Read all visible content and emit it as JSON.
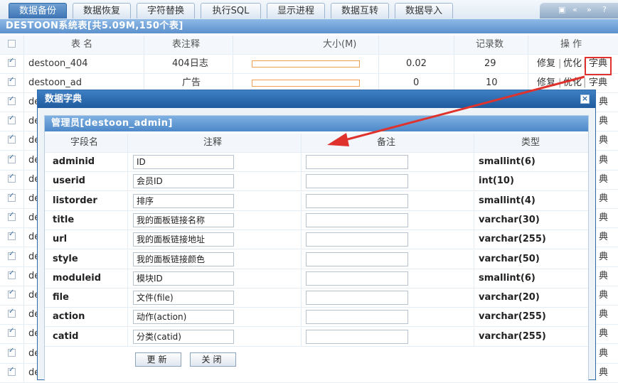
{
  "tabs": [
    {
      "label": "数据备份",
      "active": true
    },
    {
      "label": "数据恢复",
      "active": false
    },
    {
      "label": "字符替换",
      "active": false
    },
    {
      "label": "执行SQL",
      "active": false
    },
    {
      "label": "显示进程",
      "active": false
    },
    {
      "label": "数据互转",
      "active": false
    },
    {
      "label": "数据导入",
      "active": false
    }
  ],
  "toolbar_icons": [
    "pin-icon",
    "back-icon",
    "forward-icon",
    "help-icon"
  ],
  "main_title": "DESTOON系统表[共5.09M,150个表]",
  "bg_table": {
    "headers": {
      "name": "表 名",
      "comment": "表注释",
      "size": "大小(M)",
      "records": "记录数",
      "ops": "操 作"
    },
    "rows": [
      {
        "name": "destoon_404",
        "comment": "404日志",
        "size": "0.02",
        "records": "29",
        "repair": "修复",
        "optimize": "优化",
        "dict": "字典"
      },
      {
        "name": "destoon_ad",
        "comment": "广告",
        "size": "0",
        "records": "10",
        "repair": "修复",
        "optimize": "优化",
        "dict": "字典"
      }
    ],
    "partial_name": "de",
    "partial_dict": "典"
  },
  "modal": {
    "title": "数据字典",
    "close": "×",
    "table_title": "管理员[destoon_admin]",
    "headers": {
      "field": "字段名",
      "comment": "注释",
      "note": "备注",
      "type": "类型"
    },
    "fields": [
      {
        "name": "adminid",
        "comment": "ID",
        "note": "",
        "type": "smallint(6)"
      },
      {
        "name": "userid",
        "comment": "会员ID",
        "note": "",
        "type": "int(10)"
      },
      {
        "name": "listorder",
        "comment": "排序",
        "note": "",
        "type": "smallint(4)"
      },
      {
        "name": "title",
        "comment": "我的面板链接名称",
        "note": "",
        "type": "varchar(30)"
      },
      {
        "name": "url",
        "comment": "我的面板链接地址",
        "note": "",
        "type": "varchar(255)"
      },
      {
        "name": "style",
        "comment": "我的面板链接颜色",
        "note": "",
        "type": "varchar(50)"
      },
      {
        "name": "moduleid",
        "comment": "模块ID",
        "note": "",
        "type": "smallint(6)"
      },
      {
        "name": "file",
        "comment": "文件(file)",
        "note": "",
        "type": "varchar(20)"
      },
      {
        "name": "action",
        "comment": "动作(action)",
        "note": "",
        "type": "varchar(255)"
      },
      {
        "name": "catid",
        "comment": "分类(catid)",
        "note": "",
        "type": "varchar(255)"
      }
    ],
    "update_button": "更新",
    "close_button": "关闭"
  },
  "colors": {
    "highlight": "#e0322d",
    "arrow": "#e0322d",
    "accent": "#2d6aa9"
  }
}
